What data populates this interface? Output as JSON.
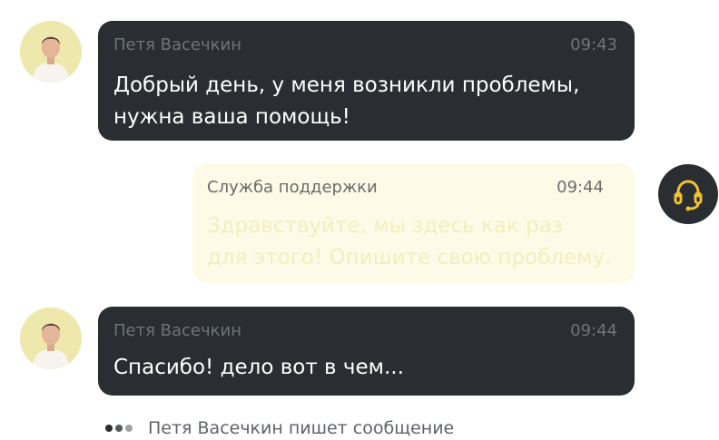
{
  "messages": [
    {
      "author": "Петя Васечкин",
      "time": "09:43",
      "text": "Добрый день, у меня возникли проблемы,\nнужна ваша помощь!"
    },
    {
      "author": "Служба поддержки",
      "time": "09:44",
      "text": "Здравствуйте, мы здесь как раз\nдля этого! Опишите свою проблему."
    },
    {
      "author": "Петя Васечкин",
      "time": "09:44",
      "text": "Спасибо! дело вот в чем..."
    }
  ],
  "typing": {
    "text": "Петя Васечкин пишет сообщение"
  },
  "icons": {
    "support": "headset-icon",
    "typing": "typing-dots-icon",
    "avatar": "user-avatar"
  },
  "colors": {
    "user_bubble": "#2a2d31",
    "support_bubble": "#fdfbe8",
    "support_text": "#f3efbc",
    "accent": "#f2c230",
    "meta_text": "#6f7478"
  }
}
